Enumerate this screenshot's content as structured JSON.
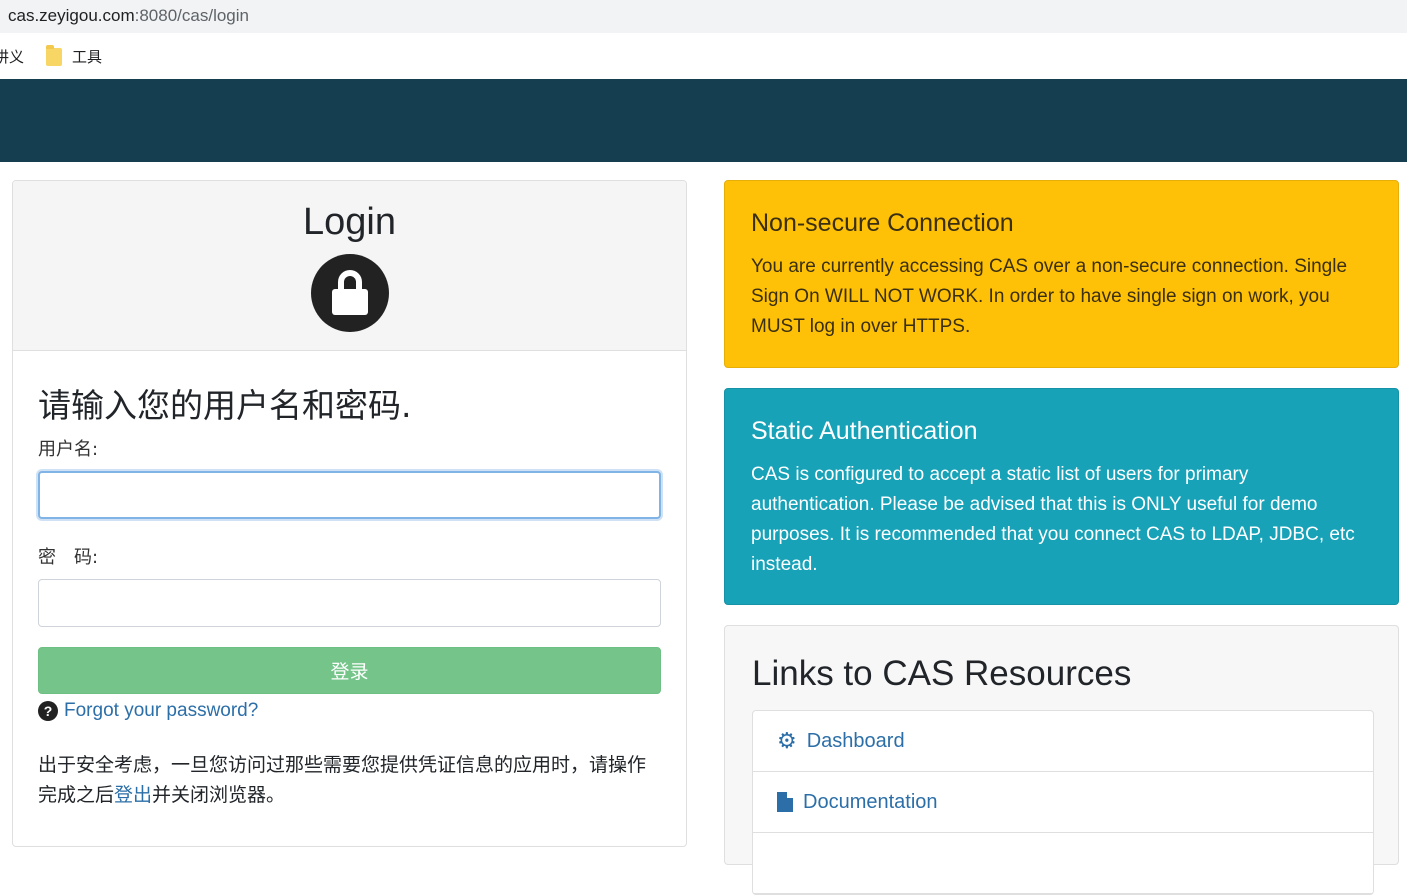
{
  "browser": {
    "url_host": "cas.zeyigou.com",
    "url_path": ":8080/cas/login",
    "bookmarks": [
      {
        "label": "讲义",
        "icon": "none"
      },
      {
        "label": "工具",
        "icon": "folder-icon"
      }
    ]
  },
  "login": {
    "title": "Login",
    "prompt": "请输入您的用户名和密码.",
    "username_label": "用户名:",
    "username_value": "",
    "password_label": "密　码:",
    "password_value": "",
    "submit_label": "登录",
    "forgot_label": "Forgot your password?",
    "notice_before": "出于安全考虑，一旦您访问过那些需要您提供凭证信息的应用时，请操作完成之后",
    "notice_link": "登出",
    "notice_after": "并关闭浏览器。"
  },
  "alerts": {
    "warning": {
      "title": "Non-secure Connection",
      "body": "You are currently accessing CAS over a non-secure connection. Single Sign On WILL NOT WORK. In order to have single sign on work, you MUST log in over HTTPS."
    },
    "info": {
      "title": "Static Authentication",
      "body": "CAS is configured to accept a static list of users for primary authentication. Please be advised that this is ONLY useful for demo purposes. It is recommended that you connect CAS to LDAP, JDBC, etc instead."
    }
  },
  "resources": {
    "title": "Links to CAS Resources",
    "items": [
      {
        "label": "Dashboard",
        "icon": "gears-icon"
      },
      {
        "label": "Documentation",
        "icon": "file-icon"
      }
    ]
  },
  "colors": {
    "banner": "#153e50",
    "warning": "#ffc107",
    "info": "#17a2b8",
    "submit": "#75c58a",
    "link": "#2c6fa8"
  }
}
